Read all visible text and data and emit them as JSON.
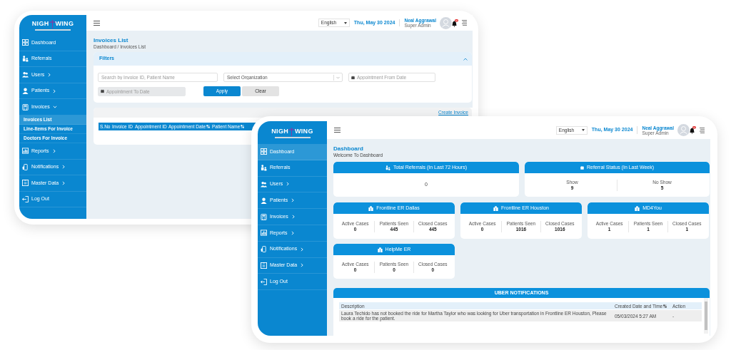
{
  "back_window": {
    "sidebar": {
      "logo": {
        "left": "NIGH",
        "right": "WING"
      },
      "items": [
        {
          "label": "Dashboard",
          "submenu": false,
          "selected": false
        },
        {
          "label": "Referrals",
          "submenu": false,
          "selected": false
        },
        {
          "label": "Users",
          "submenu": true,
          "expanded": false,
          "selected": false
        },
        {
          "label": "Patients",
          "submenu": true,
          "expanded": false,
          "selected": false
        },
        {
          "label": "Invoices",
          "submenu": true,
          "expanded": true,
          "selected": false,
          "children": [
            {
              "label": "Invoices List",
              "selected": true
            },
            {
              "label": "Line-Items For Invoice",
              "selected": false
            },
            {
              "label": "Doctors For Invoice",
              "selected": false
            }
          ]
        },
        {
          "label": "Reports",
          "submenu": true,
          "expanded": false,
          "selected": false
        },
        {
          "label": "Notifications",
          "submenu": true,
          "expanded": false,
          "selected": false
        },
        {
          "label": "Master Data",
          "submenu": true,
          "expanded": false,
          "selected": false
        },
        {
          "label": "Log Out",
          "submenu": false,
          "selected": false
        }
      ]
    },
    "header": {
      "language": "English",
      "date": "Thu, May 30 2024",
      "user_name": "Neal Aggrawal",
      "user_role": "Super Admin"
    },
    "page_title": "Invoices List",
    "breadcrumb": "Dashboard / Invoices List",
    "filters": {
      "title": "Filters",
      "expanded": true,
      "fields": [
        {
          "kind": "text",
          "placeholder": "Search by Invoice ID, Patient Name",
          "disabled": false
        },
        {
          "kind": "select",
          "placeholder": "Select Organization",
          "disabled": false
        },
        {
          "kind": "date",
          "placeholder": "Appointment From Date",
          "disabled": false
        },
        {
          "kind": "date",
          "placeholder": "Appointment To Date",
          "disabled": true
        }
      ],
      "buttons": [
        {
          "label": "Apply",
          "kind": "primary"
        },
        {
          "label": "Clear",
          "kind": "secondary"
        }
      ]
    },
    "create_link": "Create Invoice",
    "table": {
      "columns": [
        {
          "label": "S.No",
          "sortable": false
        },
        {
          "label": "Invoice ID",
          "sortable": false
        },
        {
          "label": "Appointment ID",
          "sortable": false
        },
        {
          "label": "Appointment Date",
          "sortable": true
        },
        {
          "label": "Patient Name",
          "sortable": true
        }
      ]
    }
  },
  "front_window": {
    "sidebar": {
      "logo": {
        "left": "NIGH",
        "right": "WING"
      },
      "items": [
        {
          "label": "Dashboard",
          "submenu": false,
          "selected": true
        },
        {
          "label": "Referrals",
          "submenu": false,
          "selected": false
        },
        {
          "label": "Users",
          "submenu": true,
          "expanded": false,
          "selected": false
        },
        {
          "label": "Patients",
          "submenu": true,
          "expanded": false,
          "selected": false
        },
        {
          "label": "Invoices",
          "submenu": true,
          "expanded": false,
          "selected": false
        },
        {
          "label": "Reports",
          "submenu": true,
          "expanded": false,
          "selected": false
        },
        {
          "label": "Notifications",
          "submenu": true,
          "expanded": false,
          "selected": false
        },
        {
          "label": "Master Data",
          "submenu": true,
          "expanded": false,
          "selected": false
        },
        {
          "label": "Log Out",
          "submenu": false,
          "selected": false
        }
      ]
    },
    "header": {
      "language": "English",
      "date": "Thu, May 30 2024",
      "user_name": "Neal Aggrawal",
      "user_role": "Super Admin"
    },
    "page_title": "Dashboard",
    "subtitle": "Welcome To Dashboard",
    "summary_cards": [
      {
        "kind": "referrals",
        "title": "Total Referrals (In Last 72 Hours)",
        "stats": [
          {
            "value": "0"
          }
        ]
      },
      {
        "kind": "calendar",
        "title": "Referral Status (In Last Week)",
        "stats": [
          {
            "label": "Show",
            "value": "9"
          },
          {
            "label": "No Show",
            "value": "5"
          }
        ]
      }
    ],
    "facility_cards": [
      {
        "name": "Frontline ER Dallas",
        "stats": [
          {
            "label": "Active Cases",
            "value": "0"
          },
          {
            "label": "Patients Seen",
            "value": "445"
          },
          {
            "label": "Closed Cases",
            "value": "445"
          }
        ]
      },
      {
        "name": "Frontline ER Houston",
        "stats": [
          {
            "label": "Active Cases",
            "value": "0"
          },
          {
            "label": "Patients Seen",
            "value": "1016"
          },
          {
            "label": "Closed Cases",
            "value": "1016"
          }
        ]
      },
      {
        "name": "MD4You",
        "stats": [
          {
            "label": "Active Cases",
            "value": "1"
          },
          {
            "label": "Patients Seen",
            "value": "1"
          },
          {
            "label": "Closed Cases",
            "value": "1"
          }
        ]
      },
      {
        "name": "HelpMe ER",
        "stats": [
          {
            "label": "Active Cases",
            "value": "0"
          },
          {
            "label": "Patients Seen",
            "value": "0"
          },
          {
            "label": "Closed Cases",
            "value": "0"
          }
        ]
      }
    ],
    "notifications": {
      "title": "UBER NOTIFICATIONS",
      "columns": [
        {
          "label": "Description",
          "sortable": false
        },
        {
          "label": "Created Date and Time",
          "sortable": true
        },
        {
          "label": "Action",
          "sortable": false
        }
      ],
      "rows": [
        [
          "Laura Techido has not booked the ride for Martha Taylor who was looking for Uber transportation in Frontline ER Houston, Please book a ride for the patient.",
          "05/03/2024 5:27 AM",
          "-"
        ]
      ]
    }
  }
}
